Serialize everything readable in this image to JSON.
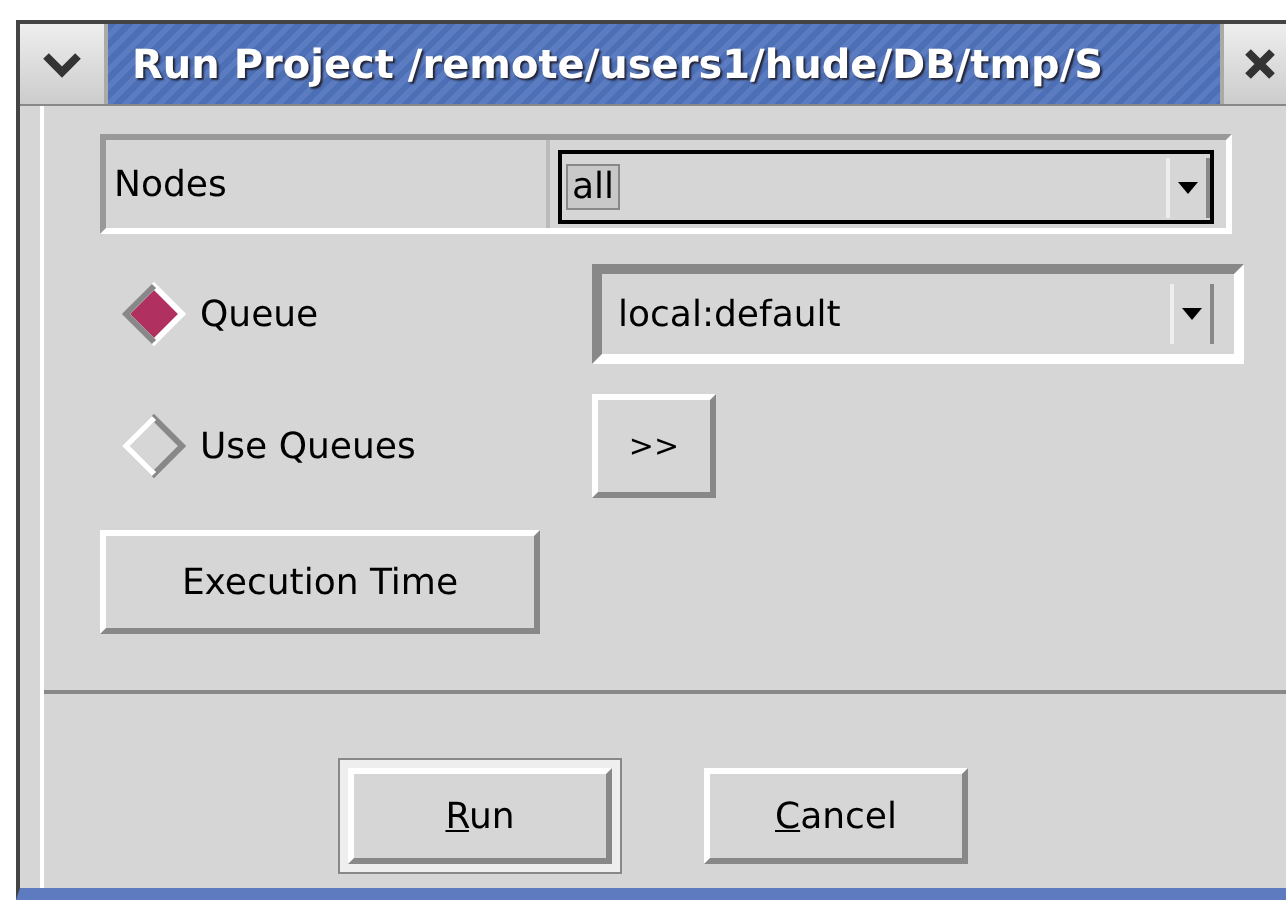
{
  "window": {
    "title": "Run Project /remote/users1/hude/DB/tmp/S"
  },
  "nodes": {
    "label": "Nodes",
    "value": "all"
  },
  "options": [
    {
      "kind": "combo",
      "label": "Queue",
      "selected": true,
      "value": "local:default"
    },
    {
      "kind": "button",
      "label": "Use Queues",
      "selected": false,
      "button": ">>"
    }
  ],
  "execution_button": "Execution Time",
  "buttons": [
    {
      "mnemonic": "R",
      "rest": "un",
      "default": true
    },
    {
      "mnemonic": "C",
      "rest": "ancel",
      "default": false
    }
  ]
}
